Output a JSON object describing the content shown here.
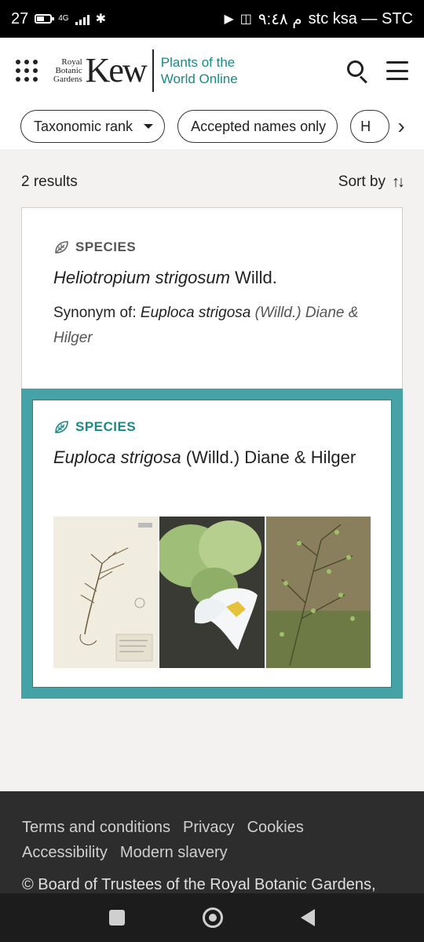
{
  "status_bar": {
    "left_text": "27",
    "net_label": "4G",
    "right_text": "stc ksa — STC",
    "time": "م ٩:٤٨"
  },
  "header": {
    "logo_line1": "Royal",
    "logo_line2": "Botanic",
    "logo_line3": "Gardens",
    "logo_kew": "Kew",
    "logo_powo_line1": "Plants of the",
    "logo_powo_line2": "World Online"
  },
  "filters": {
    "chips": [
      "Taxonomic rank",
      "Accepted names only",
      "H"
    ]
  },
  "results": {
    "count_label": "2 results",
    "sort_label": "Sort by"
  },
  "cards": [
    {
      "rank": "SPECIES",
      "name_italic": "Heliotropium strigosum",
      "author": " Willd.",
      "synonym_label": "Synonym of",
      "synonym_name": "Euploca strigosa",
      "synonym_author": " (Willd.) Diane & Hilger"
    },
    {
      "rank": "SPECIES",
      "name_italic": "Euploca strigosa",
      "author": " (Willd.) Diane & Hilger"
    }
  ],
  "footer": {
    "links": [
      "Terms and conditions",
      "Privacy",
      "Cookies",
      "Accessibility",
      "Modern slavery"
    ],
    "copyright": "© Board of Trustees of the Royal Botanic Gardens,"
  },
  "colors": {
    "accent": "#1a8a86",
    "card_highlight_border": "#45a3a7",
    "footer_bg": "#2d2d2d"
  }
}
